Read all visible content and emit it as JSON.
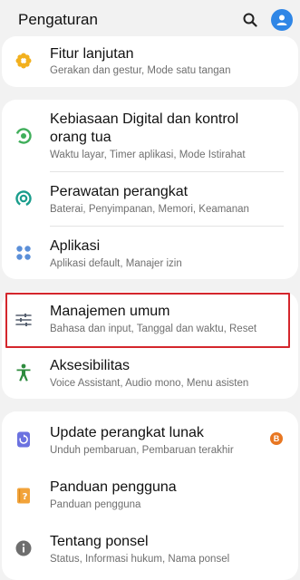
{
  "header": {
    "title": "Pengaturan"
  },
  "items": {
    "fitur": {
      "title": "Fitur lanjutan",
      "subtitle": "Gerakan dan gestur, Mode satu tangan"
    },
    "kebiasaan": {
      "title_line1": "Kebiasaan Digital dan kontrol",
      "title_line2": "orang tua",
      "subtitle": "Waktu layar, Timer aplikasi, Mode Istirahat"
    },
    "perawatan": {
      "title": "Perawatan perangkat",
      "subtitle": "Baterai, Penyimpanan, Memori, Keamanan"
    },
    "aplikasi": {
      "title": "Aplikasi",
      "subtitle": "Aplikasi default, Manajer izin"
    },
    "manajemen": {
      "title": "Manajemen umum",
      "subtitle": "Bahasa dan input, Tanggal dan waktu, Reset"
    },
    "aksesibilitas": {
      "title": "Aksesibilitas",
      "subtitle": "Voice Assistant, Audio mono, Menu asisten"
    },
    "update": {
      "title": "Update perangkat lunak",
      "subtitle": "Unduh pembaruan, Pembaruan terakhir",
      "badge": "B"
    },
    "panduan": {
      "title": "Panduan pengguna",
      "subtitle": "Panduan pengguna"
    },
    "tentang": {
      "title": "Tentang ponsel",
      "subtitle": "Status, Informasi hukum, Nama ponsel"
    }
  },
  "colors": {
    "highlight": "#d4262c",
    "avatar": "#2f86e6",
    "badge": "#e87722"
  }
}
